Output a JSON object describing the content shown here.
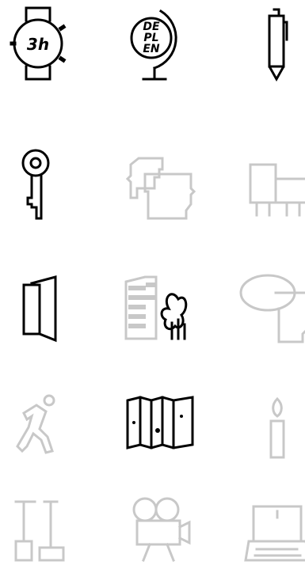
{
  "icons": {
    "watch": {
      "label": "3h",
      "active": true
    },
    "globe": {
      "line1": "DE",
      "line2": "PL",
      "line3": "EN",
      "active": true
    },
    "pen": {
      "active": true
    },
    "key": {
      "active": true
    },
    "faces": {
      "active": false
    },
    "screens": {
      "active": false
    },
    "booklet": {
      "active": true
    },
    "building-trees": {
      "active": false
    },
    "thought": {
      "active": false
    },
    "runner": {
      "active": false
    },
    "map": {
      "active": true
    },
    "candle": {
      "active": false
    },
    "tools": {
      "active": false
    },
    "camera": {
      "active": false
    },
    "laptop": {
      "active": false
    }
  },
  "colors": {
    "active": "#000000",
    "inactive": "#c8c8c8"
  }
}
